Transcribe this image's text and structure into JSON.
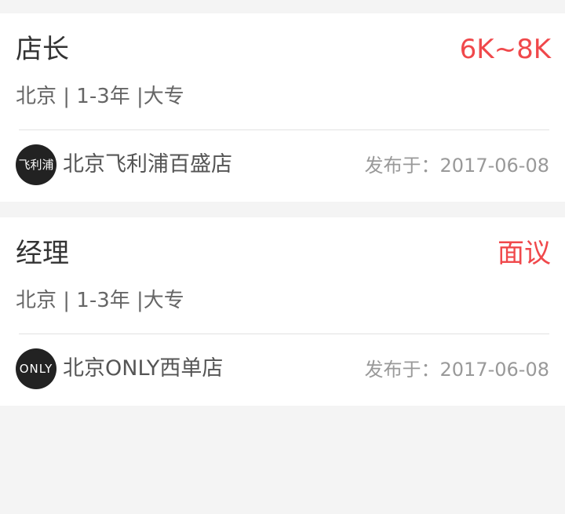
{
  "jobs": [
    {
      "title": "店长",
      "salary": "6K~8K",
      "meta": "北京 | 1-3年 |大专",
      "company": {
        "logo_text": "飞利浦",
        "name": "北京飞利浦百盛店"
      },
      "published": "发布于：2017-06-08"
    },
    {
      "title": "经理",
      "salary": "面议",
      "meta": "北京 | 1-3年 |大专",
      "company": {
        "logo_text": "ONLY",
        "name": "北京ONLY西单店"
      },
      "published": "发布于：2017-06-08"
    }
  ],
  "colors": {
    "salary": "#f0484b",
    "background": "#f4f4f4",
    "card": "#ffffff"
  }
}
